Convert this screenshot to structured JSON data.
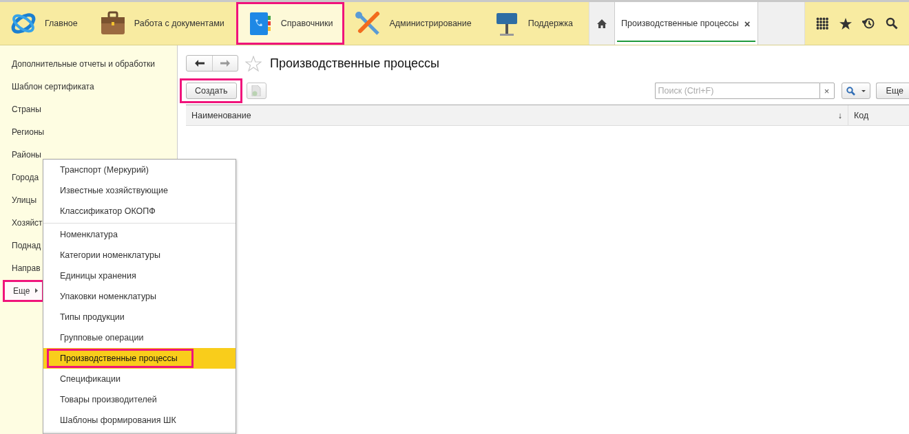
{
  "sections": [
    {
      "label": "Главное",
      "kind": "logo",
      "selected": false,
      "highlighted": false
    },
    {
      "label": "Работа с документами",
      "kind": "briefcase",
      "selected": false,
      "highlighted": false
    },
    {
      "label": "Справочники",
      "kind": "notebook",
      "selected": true,
      "highlighted": true
    },
    {
      "label": "Администрирование",
      "kind": "tools",
      "selected": false,
      "highlighted": false
    },
    {
      "label": "Поддержка",
      "kind": "sign",
      "selected": false,
      "highlighted": false
    }
  ],
  "open_tabs": [
    {
      "label": "Производственные процессы",
      "close": "×",
      "selected": true
    }
  ],
  "sidebar": {
    "items": [
      {
        "label": "Дополнительные отчеты и обработки",
        "kind": "link"
      },
      {
        "label": "Шаблон сертификата",
        "kind": "link"
      },
      {
        "label": "Страны",
        "kind": "link"
      },
      {
        "label": "Регионы",
        "kind": "link"
      },
      {
        "label": "Районы",
        "kind": "link"
      },
      {
        "label": "Города",
        "kind": "link"
      },
      {
        "label": "Улицы",
        "kind": "link"
      },
      {
        "label": "Хозяйст",
        "kind": "link"
      },
      {
        "label": "Поднад",
        "kind": "link"
      },
      {
        "label": "Направ",
        "kind": "link"
      },
      {
        "label": "Еще",
        "kind": "more",
        "highlighted": true
      }
    ]
  },
  "page": {
    "title": "Производственные процессы",
    "create_button": {
      "label": "Создать",
      "highlighted": true
    },
    "search": {
      "placeholder": "Поиск (Ctrl+F)",
      "clear": "×"
    },
    "more_button": "Еще",
    "table": {
      "columns": [
        {
          "label": "Наименование",
          "sort": "↓"
        },
        {
          "label": "Код"
        }
      ]
    }
  },
  "menu": {
    "groups": [
      {
        "items": [
          {
            "label": "Транспорт (Меркурий)",
            "selected": false,
            "highlighted": false
          },
          {
            "label": "Известные хозяйствующие",
            "selected": false,
            "highlighted": false
          },
          {
            "label": "Классификатор ОКОПФ",
            "selected": false,
            "highlighted": false
          }
        ]
      },
      {
        "items": [
          {
            "label": "Номенклатура",
            "selected": false,
            "highlighted": false
          },
          {
            "label": "Категории номенклатуры",
            "selected": false,
            "highlighted": false
          },
          {
            "label": "Единицы хранения",
            "selected": false,
            "highlighted": false
          },
          {
            "label": "Упаковки номенклатуры",
            "selected": false,
            "highlighted": false
          },
          {
            "label": "Типы продукции",
            "selected": false,
            "highlighted": false
          },
          {
            "label": "Групповые операции",
            "selected": false,
            "highlighted": false
          },
          {
            "label": "Производственные процессы",
            "selected": true,
            "highlighted": true
          },
          {
            "label": "Спецификации",
            "selected": false,
            "highlighted": false
          },
          {
            "label": "Товары производителей",
            "selected": false,
            "highlighted": false
          },
          {
            "label": "Шаблоны формирования ШК",
            "selected": false,
            "highlighted": false
          }
        ]
      }
    ]
  }
}
